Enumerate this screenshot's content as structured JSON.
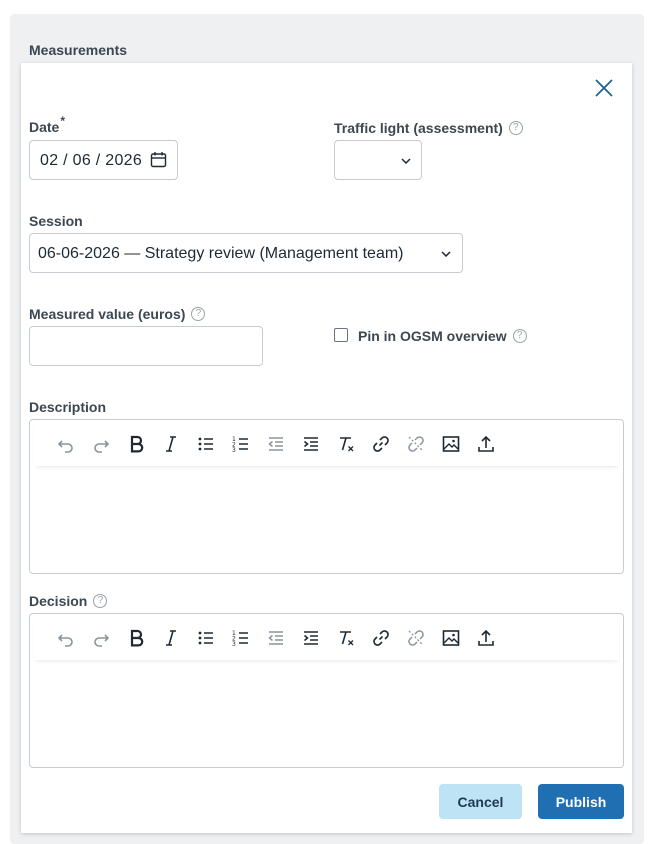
{
  "section_title": "Measurements",
  "form": {
    "date": {
      "label": "Date",
      "required_mark": "*",
      "value": "02 / 06 / 2026"
    },
    "traffic_light": {
      "label": "Traffic light (assessment)",
      "value": ""
    },
    "session": {
      "label": "Session",
      "value": "06-06-2026 — Strategy review (Management team)"
    },
    "measured_value": {
      "label": "Measured value (euros)",
      "value": ""
    },
    "pin": {
      "label": "Pin in OGSM overview",
      "checked": false
    },
    "description": {
      "label": "Description"
    },
    "decision": {
      "label": "Decision"
    }
  },
  "toolbar_icons": [
    "undo-icon",
    "redo-icon",
    "bold-icon",
    "italic-icon",
    "bullet-list-icon",
    "numbered-list-icon",
    "outdent-icon",
    "indent-icon",
    "clear-format-icon",
    "link-icon",
    "unlink-icon",
    "image-icon",
    "upload-icon"
  ],
  "help_glyph": "?",
  "buttons": {
    "cancel": "Cancel",
    "publish": "Publish"
  },
  "colors": {
    "publish_bg": "#1f6fb2",
    "cancel_bg": "#bde3f5",
    "close_icon": "#1f5f91"
  }
}
